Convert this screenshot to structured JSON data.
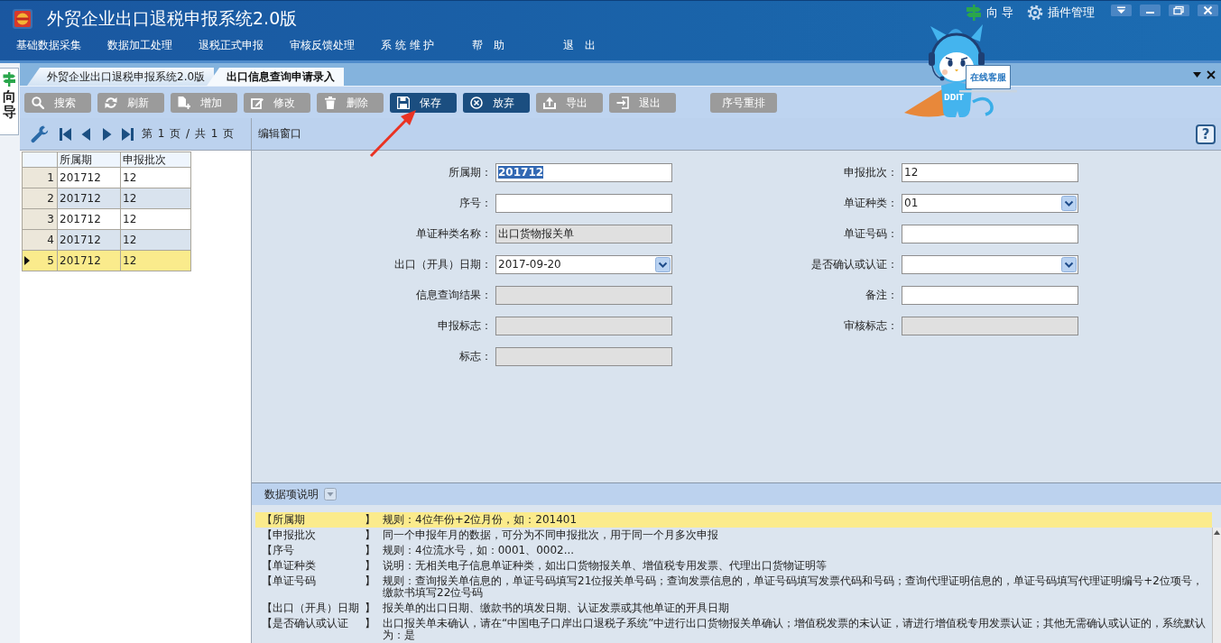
{
  "window": {
    "title": "外贸企业出口退税申报系统2.0版"
  },
  "header_links": [
    {
      "label": "向 导"
    },
    {
      "label": "插件管理"
    }
  ],
  "menu": [
    {
      "label": "基础数据采集"
    },
    {
      "label": "数据加工处理"
    },
    {
      "label": "退税正式申报"
    },
    {
      "label": "审核反馈处理"
    },
    {
      "label": "系 统 维 护"
    },
    {
      "label": "帮　助"
    },
    {
      "label": "退　出"
    }
  ],
  "side_tab": {
    "label": "向导"
  },
  "mascot": {
    "chest_text": "DDIT",
    "sign": "在线客服"
  },
  "tabs": [
    {
      "label": "外贸企业出口退税申报系统2.0版",
      "selected": false
    },
    {
      "label": "出口信息查询申请录入",
      "selected": true
    }
  ],
  "toolbar": {
    "buttons": [
      {
        "label": "搜索",
        "highlighted": false
      },
      {
        "label": "刷新",
        "highlighted": false
      },
      {
        "label": "增加",
        "highlighted": false
      },
      {
        "label": "修改",
        "highlighted": false
      },
      {
        "label": "删除",
        "highlighted": false
      },
      {
        "label": "保存",
        "highlighted": true
      },
      {
        "label": "放弃",
        "highlighted": true
      },
      {
        "label": "导出",
        "highlighted": false
      },
      {
        "label": "退出",
        "highlighted": false
      }
    ],
    "extra_buttons": [
      {
        "label": "序号重排",
        "highlighted": false
      }
    ]
  },
  "list_panel": {
    "pager": "第 1 页 / 共 1 页",
    "columns": [
      "所属期",
      "申报批次"
    ],
    "rows": [
      {
        "number": "1",
        "cells": [
          "201712",
          "12"
        ],
        "selected": false
      },
      {
        "number": "2",
        "cells": [
          "201712",
          "12"
        ],
        "selected": false
      },
      {
        "number": "3",
        "cells": [
          "201712",
          "12"
        ],
        "selected": false
      },
      {
        "number": "4",
        "cells": [
          "201712",
          "12"
        ],
        "selected": false
      },
      {
        "number": "5",
        "cells": [
          "201712",
          "12"
        ],
        "selected": true
      }
    ]
  },
  "edit_panel": {
    "title": "编辑窗口",
    "help": "?",
    "left_fields": [
      {
        "label": "所属期：",
        "value": "201712",
        "kind": "text",
        "disabled": false,
        "text_selected": true
      },
      {
        "label": "序号：",
        "kind": "text",
        "disabled": false
      },
      {
        "label": "单证种类名称：",
        "value": "出口货物报关单",
        "kind": "text",
        "disabled": true,
        "text_selected": false
      },
      {
        "label": "出口（开具）日期：",
        "value": "2017-09-20",
        "kind": "dropdown",
        "disabled": false,
        "text_selected": false
      },
      {
        "label": "信息查询结果：",
        "kind": "text",
        "disabled": true
      },
      {
        "label": "申报标志：",
        "kind": "text",
        "disabled": true
      },
      {
        "label": "标志：",
        "kind": "text",
        "disabled": true
      }
    ],
    "right_fields": [
      {
        "label": "申报批次：",
        "value": "12",
        "kind": "text",
        "disabled": false,
        "text_selected": false
      },
      {
        "label": "单证种类：",
        "value": "01",
        "kind": "dropdown",
        "disabled": false,
        "text_selected": false
      },
      {
        "label": "单证号码：",
        "kind": "text",
        "disabled": false
      },
      {
        "label": "是否确认或认证：",
        "kind": "dropdown",
        "disabled": false
      },
      {
        "label": "备注：",
        "kind": "text",
        "disabled": false
      },
      {
        "label": "审核标志：",
        "kind": "text",
        "disabled": true
      }
    ]
  },
  "notes": {
    "title": "数据项说明",
    "rows": [
      {
        "label": "【所属期",
        "close": "】",
        "text": "规则：4位年份+2位月份，如：201401",
        "selected": true
      },
      {
        "label": "【申报批次",
        "close": "】",
        "text": "同一个申报年月的数据，可分为不同申报批次，用于同一个月多次申报",
        "selected": false
      },
      {
        "label": "【序号",
        "close": "】",
        "text": "规则：4位流水号，如：0001、0002...",
        "selected": false
      },
      {
        "label": "【单证种类",
        "close": "】",
        "text": "说明：无相关电子信息单证种类，如出口货物报关单、增值税专用发票、代理出口货物证明等",
        "selected": false
      },
      {
        "label": "【单证号码",
        "close": "】",
        "text": "规则：查询报关单信息的，单证号码填写21位报关单号码；查询发票信息的，单证号码填写发票代码和号码；查询代理证明信息的，单证号码填写代理证明编号+2位项号，缴款书填写22位号码",
        "selected": false
      },
      {
        "label": "【出口（开具）日期",
        "close": "】",
        "text": "报关单的出口日期、缴款书的填发日期、认证发票或其他单证的开具日期",
        "selected": false
      },
      {
        "label": "【是否确认或认证",
        "close": "】",
        "text": "出口报关单未确认，请在“中国电子口岸出口退税子系统”中进行出口货物报关单确认；增值税发票的未认证，请进行增值税专用发票认证；其他无需确认或认证的，系统默认为：是",
        "selected": false
      }
    ]
  }
}
